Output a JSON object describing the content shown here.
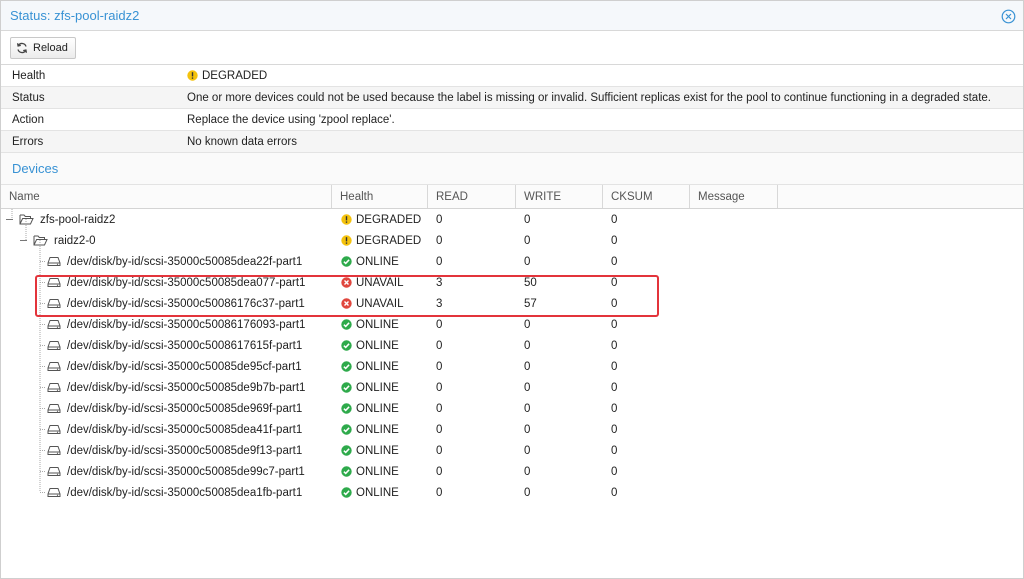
{
  "window": {
    "title": "Status: zfs-pool-raidz2"
  },
  "toolbar": {
    "reload_label": "Reload"
  },
  "status_info": {
    "rows": [
      {
        "key": "Health",
        "value": "DEGRADED",
        "icon": "warning-icon"
      },
      {
        "key": "Status",
        "value": "One or more devices could not be used because the label is missing or invalid. Sufficient replicas exist for the pool to continue functioning in a degraded state."
      },
      {
        "key": "Action",
        "value": "Replace the device using 'zpool replace'."
      },
      {
        "key": "Errors",
        "value": "No known data errors"
      }
    ]
  },
  "devices": {
    "title": "Devices",
    "columns": [
      "Name",
      "Health",
      "READ",
      "WRITE",
      "CKSUM",
      "Message"
    ],
    "rows": [
      {
        "name": "zfs-pool-raidz2",
        "type": "pool",
        "health": "DEGRADED",
        "read": "0",
        "write": "0",
        "cksum": "0"
      },
      {
        "name": "raidz2-0",
        "type": "vdev",
        "health": "DEGRADED",
        "read": "0",
        "write": "0",
        "cksum": "0"
      },
      {
        "name": "/dev/disk/by-id/scsi-35000c50085dea22f-part1",
        "type": "disk",
        "health": "ONLINE",
        "read": "0",
        "write": "0",
        "cksum": "0"
      },
      {
        "name": "/dev/disk/by-id/scsi-35000c50085dea077-part1",
        "type": "disk",
        "health": "UNAVAIL",
        "read": "3",
        "write": "50",
        "cksum": "0"
      },
      {
        "name": "/dev/disk/by-id/scsi-35000c50086176c37-part1",
        "type": "disk",
        "health": "UNAVAIL",
        "read": "3",
        "write": "57",
        "cksum": "0"
      },
      {
        "name": "/dev/disk/by-id/scsi-35000c50086176093-part1",
        "type": "disk",
        "health": "ONLINE",
        "read": "0",
        "write": "0",
        "cksum": "0"
      },
      {
        "name": "/dev/disk/by-id/scsi-35000c5008617615f-part1",
        "type": "disk",
        "health": "ONLINE",
        "read": "0",
        "write": "0",
        "cksum": "0"
      },
      {
        "name": "/dev/disk/by-id/scsi-35000c50085de95cf-part1",
        "type": "disk",
        "health": "ONLINE",
        "read": "0",
        "write": "0",
        "cksum": "0"
      },
      {
        "name": "/dev/disk/by-id/scsi-35000c50085de9b7b-part1",
        "type": "disk",
        "health": "ONLINE",
        "read": "0",
        "write": "0",
        "cksum": "0"
      },
      {
        "name": "/dev/disk/by-id/scsi-35000c50085de969f-part1",
        "type": "disk",
        "health": "ONLINE",
        "read": "0",
        "write": "0",
        "cksum": "0"
      },
      {
        "name": "/dev/disk/by-id/scsi-35000c50085dea41f-part1",
        "type": "disk",
        "health": "ONLINE",
        "read": "0",
        "write": "0",
        "cksum": "0"
      },
      {
        "name": "/dev/disk/by-id/scsi-35000c50085de9f13-part1",
        "type": "disk",
        "health": "ONLINE",
        "read": "0",
        "write": "0",
        "cksum": "0"
      },
      {
        "name": "/dev/disk/by-id/scsi-35000c50085de99c7-part1",
        "type": "disk",
        "health": "ONLINE",
        "read": "0",
        "write": "0",
        "cksum": "0"
      },
      {
        "name": "/dev/disk/by-id/scsi-35000c50085dea1fb-part1",
        "type": "disk",
        "health": "ONLINE",
        "read": "0",
        "write": "0",
        "cksum": "0"
      }
    ]
  },
  "colors": {
    "accent": "#3892d4",
    "warning": "#f4c20d",
    "error": "#e0473e",
    "ok": "#2eaa4b",
    "highlight": "#e3343b"
  }
}
